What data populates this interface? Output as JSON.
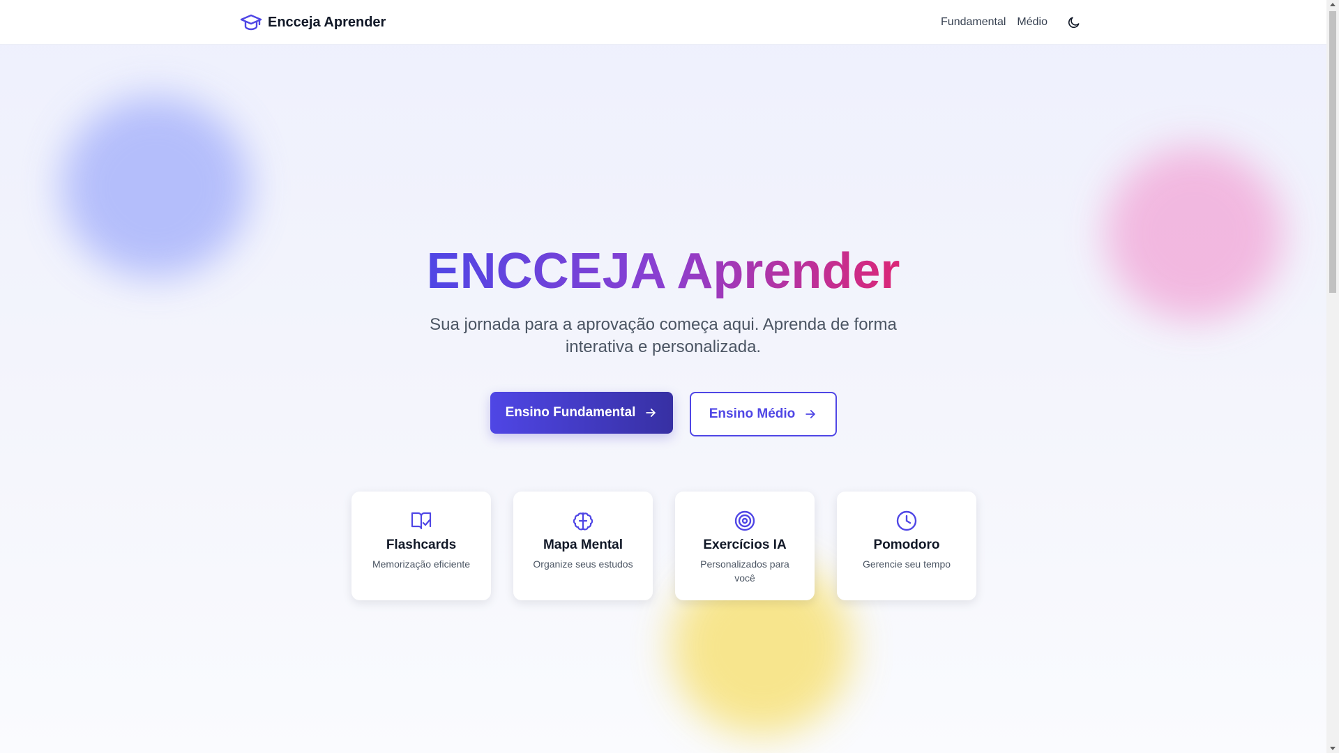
{
  "header": {
    "brand_icon": "graduation-cap-icon",
    "brand_name": "Encceja Aprender",
    "nav": [
      {
        "label": "Fundamental"
      },
      {
        "label": "Médio"
      }
    ],
    "theme_toggle_icon": "moon-icon"
  },
  "hero": {
    "title": "ENCCEJA Aprender",
    "subtitle": "Sua jornada para a aprovação começa aqui. Aprenda de forma interativa e personalizada.",
    "primary_cta": "Ensino Fundamental",
    "secondary_cta": "Ensino Médio",
    "cta_icon": "arrow-right-icon"
  },
  "features": [
    {
      "icon": "book-check-icon",
      "title": "Flashcards",
      "description": "Memorização eficiente"
    },
    {
      "icon": "brain-icon",
      "title": "Mapa Mental",
      "description": "Organize seus estudos"
    },
    {
      "icon": "target-icon",
      "title": "Exercícios IA",
      "description": "Personalizados para você"
    },
    {
      "icon": "clock-icon",
      "title": "Pomodoro",
      "description": "Gerencie seu tempo"
    }
  ],
  "colors": {
    "accent": "#4f46e5",
    "gradient_start": "#4f46e5",
    "gradient_end": "#db2777",
    "blob_blue": "#aab5fb",
    "blob_pink": "#f2aedb",
    "blob_yellow": "#f7e27a"
  }
}
